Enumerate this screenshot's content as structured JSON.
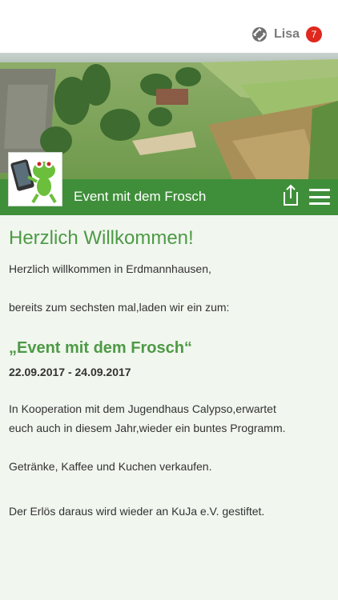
{
  "header": {
    "user_name": "Lisa",
    "badge_count": "7"
  },
  "app": {
    "title": "Event mit dem Frosch"
  },
  "content": {
    "welcome": "Herzlich Willkommen!",
    "greeting": "Herzlich willkommen in Erdmannhausen,",
    "intro": "bereits zum sechsten mal,laden wir ein zum:",
    "event_title": "„Event mit dem Frosch“",
    "dates": "22.09.2017 - 24.09.2017",
    "cooperation_line1": "In Kooperation mit dem Jugendhaus Calypso,erwartet",
    "cooperation_line2": "euch auch in diesem Jahr,wieder ein buntes Programm.",
    "refreshments": "Getränke, Kaffee und Kuchen verkaufen.",
    "donation": "Der Erlös daraus wird wieder an KuJa e.V. gestiftet."
  },
  "colors": {
    "accent_green": "#3f8f3a",
    "heading_green": "#4d9a45",
    "badge_red": "#e0281e",
    "background": "#f1f6ef"
  },
  "icons": [
    "user-status-icon",
    "share-icon",
    "menu-icon",
    "frog-logo"
  ]
}
